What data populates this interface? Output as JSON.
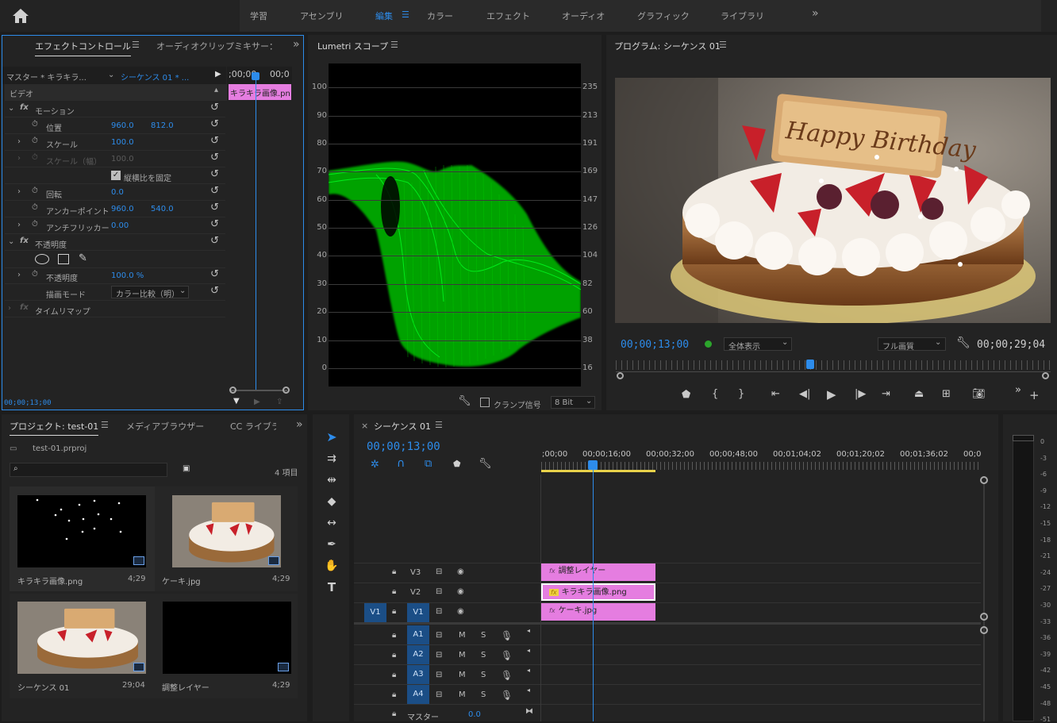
{
  "workspaces": [
    "学習",
    "アセンブリ",
    "編集",
    "カラー",
    "エフェクト",
    "オーディオ",
    "グラフィック",
    "ライブラリ"
  ],
  "active_workspace": "編集",
  "effect_controls": {
    "tab": "エフェクトコントロール",
    "tab2": "オーディオクリップミキサー：シ",
    "source": "マスター * キラキラ...",
    "sequence": "シーケンス 01 * ...",
    "ruler_a": ";00;00",
    "ruler_b": "00;0",
    "clip_label": "キラキラ画像.pn",
    "section": "ビデオ",
    "motion": "モーション",
    "position": "位置",
    "pos_x": "960.0",
    "pos_y": "812.0",
    "scale": "スケール",
    "scale_val": "100.0",
    "scale_w": "スケール（幅）",
    "scale_w_val": "100.0",
    "uniform": "縦横比を固定",
    "rotation": "回転",
    "rotation_val": "0.0",
    "anchor": "アンカーポイント",
    "anchor_x": "960.0",
    "anchor_y": "540.0",
    "antiflicker": "アンチフリッカー",
    "antiflicker_val": "0.00",
    "opacity_fx": "不透明度",
    "opacity": "不透明度",
    "opacity_val": "100.0 %",
    "blend": "描画モード",
    "blend_val": "カラー比較（明）",
    "timeremap": "タイムリマップ",
    "timecode": "00;00;13;00"
  },
  "lumetri": {
    "title": "Lumetri スコープ",
    "left_axis": [
      "100",
      "90",
      "80",
      "70",
      "60",
      "50",
      "40",
      "30",
      "20",
      "10",
      "0"
    ],
    "right_axis": [
      "235",
      "213",
      "191",
      "169",
      "147",
      "126",
      "104",
      "82",
      "60",
      "38",
      "16"
    ],
    "clamp": "クランプ信号",
    "bit": "8 Bit"
  },
  "program": {
    "title": "プログラム: シーケンス 01",
    "timecode": "00;00;13;00",
    "zoom": "全体表示",
    "quality": "フル画質",
    "duration": "00;00;29;04",
    "playhead_fraction": 0.447,
    "image_text": "Happy Birthday"
  },
  "project": {
    "tab": "プロジェクト: test-01",
    "tab2": "メディアブラウザー",
    "tab3": "CC ライブラ",
    "file": "test-01.prproj",
    "count": "4 項目",
    "items": [
      {
        "name": "キラキラ画像.png",
        "dur": "4;29"
      },
      {
        "name": "ケーキ.jpg",
        "dur": "4;29"
      },
      {
        "name": "シーケンス 01",
        "dur": "29;04"
      },
      {
        "name": "調整レイヤー",
        "dur": "4;29"
      }
    ]
  },
  "timeline": {
    "tab": "シーケンス 01",
    "timecode": "00;00;13;00",
    "ruler": [
      ";00;00",
      "00;00;16;00",
      "00;00;32;00",
      "00;00;48;00",
      "00;01;04;02",
      "00;01;20;02",
      "00;01;36;02",
      "00;0"
    ],
    "tracks": [
      "V3",
      "V2",
      "V1",
      "A1",
      "A2",
      "A3",
      "A4"
    ],
    "source_v1": "V1",
    "clips": [
      "調整レイヤー",
      "キラキラ画像.png",
      "ケーキ.jpg"
    ],
    "master": "マスター",
    "master_val": "0.0",
    "m": "M",
    "s": "S"
  },
  "meter": {
    "ticks": [
      "0",
      "-3",
      "-6",
      "-9",
      "-12",
      "-15",
      "-18",
      "-21",
      "-24",
      "-27",
      "-30",
      "-33",
      "-36",
      "-39",
      "-42",
      "-45",
      "-48",
      "-51"
    ]
  },
  "colors": {
    "accent": "#2d8ceb",
    "clip": "#e57de0",
    "scope": "#00c400"
  }
}
